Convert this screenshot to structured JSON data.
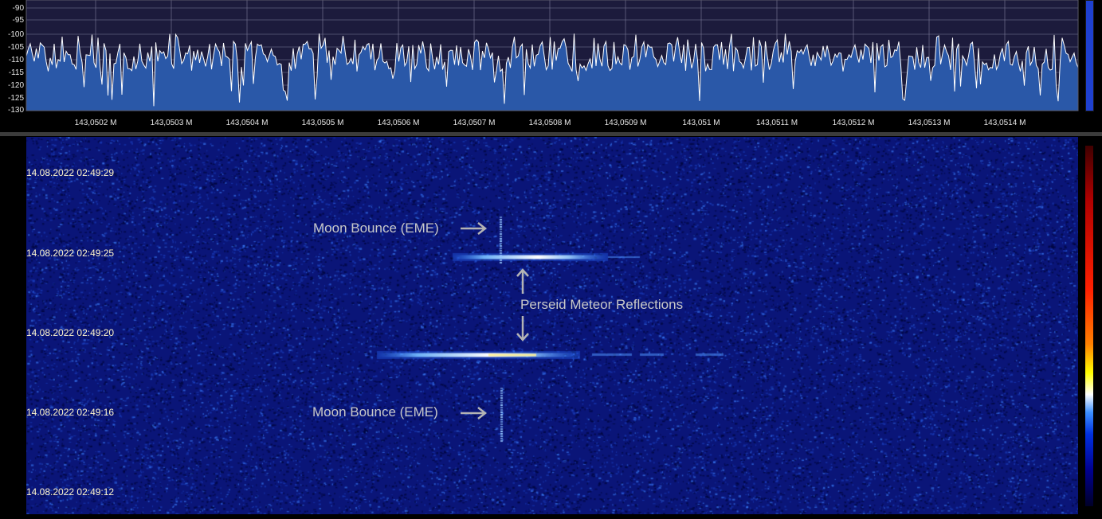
{
  "spectrum": {
    "y_ticks": [
      "-90",
      "-95",
      "-100",
      "-105",
      "-110",
      "-115",
      "-120",
      "-125",
      "-130"
    ],
    "x_ticks": [
      "143,0502 M",
      "143,0503 M",
      "143,0504 M",
      "143,0505 M",
      "143,0506 M",
      "143,0507 M",
      "143,0508 M",
      "143,0509 M",
      "143,051 M",
      "143,0511 M",
      "143,0512 M",
      "143,0513 M",
      "143,0514 M"
    ],
    "ylim": [
      -130,
      -88
    ],
    "colors": {
      "fill": "#2a58a8",
      "line": "#ffffff",
      "background": "#1c1b3c",
      "grid": "#7e7e9c",
      "axis_text": "#e6e6e6"
    }
  },
  "signal_level": {
    "fraction": 1.0,
    "color": "#1e40d0"
  },
  "waterfall": {
    "timestamps": [
      "14.08.2022 02:49:29",
      "14.08.2022 02:49:25",
      "14.08.2022 02:49:20",
      "14.08.2022 02:49:16",
      "14.08.2022 02:49:12"
    ],
    "annotations": {
      "moon_bounce_top": "Moon Bounce (EME)",
      "meteor": "Perseid Meteor Reflections",
      "moon_bounce_bottom": "Moon Bounce (EME)"
    },
    "colors": {
      "background": "#0a1578",
      "annotation": "#c8c8c8",
      "timestamp": "#fff6cc"
    }
  }
}
